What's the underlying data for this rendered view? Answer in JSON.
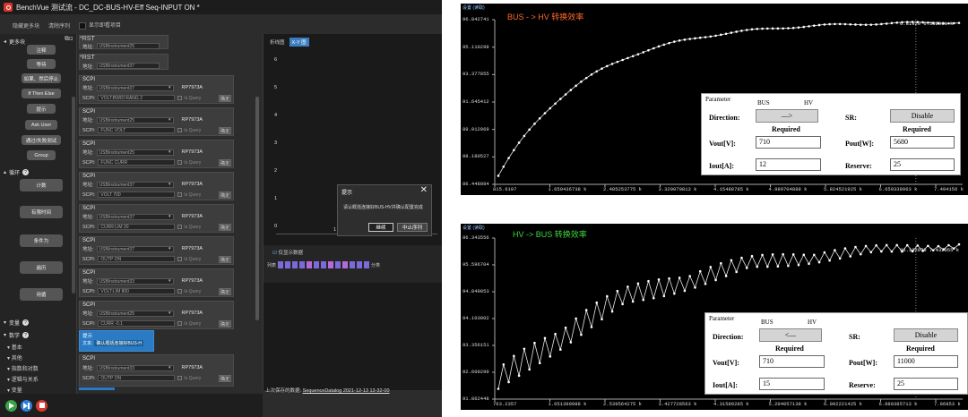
{
  "app": {
    "title": "BenchVue 测试流 - DC_DC-BUS-HV-Eff Seq-INPUT ON *",
    "menu": [
      "隐藏更多块",
      "清除序列",
      "显示即看项目"
    ],
    "palette": {
      "more_blocks": "更多块",
      "blocks_top": [
        "注释",
        "等待",
        "如果、然后停止",
        "If Then Else",
        "提示",
        "Ask User",
        "通过/失败测试",
        "Group"
      ],
      "loop_section": "循环",
      "loop_blocks": [
        "计数",
        "有限时间",
        "条件为",
        "遍历",
        "用循"
      ],
      "variables_section": "变量",
      "data_section": "数学",
      "tree": [
        "基本",
        "其他",
        "指数和对数",
        "逻辑与关系",
        "变量"
      ]
    },
    "sequence": {
      "rst_blocks": [
        {
          "label": "*RST",
          "addr_label": "地址:",
          "address": "USBInstrument25"
        },
        {
          "label": "*RST",
          "addr_label": "地址:",
          "address": "USBInstrument37"
        }
      ],
      "scpi_blocks": [
        {
          "label": "SCPI",
          "address": "USBInstrument37",
          "model": "RP7973A",
          "command": "VOLT:BWID:RANG 2"
        },
        {
          "label": "SCPI",
          "address": "USBInstrument25",
          "model": "RP7973A",
          "command": "FUNC VOLT"
        },
        {
          "label": "SCPI",
          "address": "USBInstrument25",
          "model": "RP7973A",
          "command": "FUNC CURR"
        },
        {
          "label": "SCPI",
          "address": "USBInstrument37",
          "model": "RP7973A",
          "command": "VOLT 700"
        },
        {
          "label": "SCPI",
          "address": "USBInstrument37",
          "model": "RP7973A",
          "command": "CURR:LIM 30"
        },
        {
          "label": "SCPI",
          "address": "USBInstrument37",
          "model": "RP7973A",
          "command": "OUTP ON"
        },
        {
          "label": "SCPI",
          "address": "USBInstrument33",
          "model": "RP7973A",
          "command": "VOLT:LIM 800"
        },
        {
          "label": "SCPI",
          "address": "USBInstrument25",
          "model": "RP7973A",
          "command": "CURR -0.1"
        }
      ],
      "tip_block": {
        "label": "提示",
        "prefix": "文本:",
        "text": "确认概括连接好BUS-H"
      },
      "last_scpi": {
        "label": "SCPI",
        "address": "USBInstrument33",
        "model": "RP7973A",
        "command": "OUTP ON"
      },
      "addr_label": "地址:",
      "scpi_label": "SCPI:",
      "query_label": "Is Query",
      "confirm_label": "确定"
    },
    "right_panel": {
      "tabs": [
        "折线图",
        "X-Y 图"
      ],
      "yticks": [
        "6",
        "5",
        "4",
        "3",
        "2",
        "1",
        "0"
      ],
      "xtick": "1",
      "dialog": {
        "title": "提示",
        "message": "请认概括连接好BUS-HV并确认配置完成",
        "ok": "继续",
        "stop": "中止序列"
      },
      "data_header": "仅显示数据",
      "data_row_label": "列表",
      "data_row_end": "分类",
      "footer_label": "上次保存的数据:",
      "footer_link": "SequenceDatalog 2021-12-13 13-32-00"
    }
  },
  "plot1": {
    "corner": "设置 (读取)",
    "title": "BUS - > HV 转换效率",
    "title_color": "#ff6a2a",
    "yticks": [
      "96.842741",
      "95.110298",
      "93.377855",
      "91.645412",
      "89.912969",
      "88.180527",
      "86.448084"
    ],
    "xticks": [
      "815.6197",
      "1.650436738 k",
      "2.485253775 k",
      "3.320070813 k",
      "4.15488785 k",
      "4.989704888 k",
      "5.824521925 k",
      "6.659338963 k",
      "7.494156 k"
    ],
    "readout": "6.81929 6.552091 k",
    "panel": {
      "title": "Parameter",
      "from": "BUS",
      "to": "HV",
      "direction_label": "Direction:",
      "direction_value": "—>",
      "sr_label": "SR:",
      "sr_value": "Disable",
      "required": "Required",
      "vout_label": "Vout[V]:",
      "vout": "710",
      "pout_label": "Pout[W]:",
      "pout": "5680",
      "iout_label": "Iout[A]:",
      "iout": "12",
      "reserve_label": "Reserve:",
      "reserve": "25"
    }
  },
  "plot2": {
    "corner": "设置 (读取)",
    "title": "HV -> BUS 转换效率",
    "title_color": "#3ed83e",
    "yticks": [
      "96.343556",
      "95.596704",
      "94.849853",
      "94.103002",
      "93.356151",
      "92.609299",
      "91.862448"
    ],
    "xticks": [
      "763.2357",
      "1.651399988 k",
      "2.539564275 k",
      "3.427728563 k",
      "4.31589285 k",
      "5.204057138 k",
      "6.092221425 k",
      "6.980385713 k",
      "7.86853 k"
    ],
    "readout": "96.192978 7.432055 k",
    "panel": {
      "title": "Parameter",
      "from": "BUS",
      "to": "HV",
      "direction_label": "Direction:",
      "direction_value": "<—",
      "sr_label": "SR:",
      "sr_value": "Disable",
      "required": "Required",
      "vout_label": "Vout[V]:",
      "vout": "710",
      "pout_label": "Pout[W]:",
      "pout": "11000",
      "iout_label": "Iout[A]:",
      "iout": "15",
      "reserve_label": "Reserve:",
      "reserve": "25"
    }
  }
}
